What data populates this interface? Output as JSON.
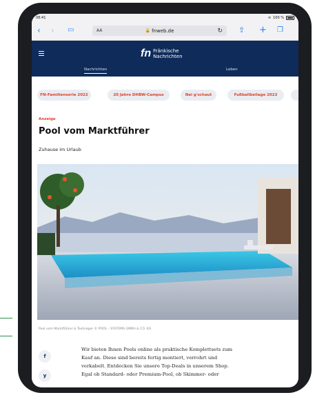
{
  "status": {
    "time": "08:41",
    "battery": "100 %"
  },
  "browser": {
    "text_size_label": "AA",
    "url": "fnweb.de",
    "icons": [
      "back-icon",
      "forward-icon",
      "book-icon",
      "lock-icon",
      "reload-icon",
      "share-icon",
      "plus-icon",
      "tabs-icon"
    ]
  },
  "site": {
    "logo_mark": "fn",
    "logo_line1": "Fränkische",
    "logo_line2": "Nachrichten",
    "nav": [
      {
        "label": "Nachrichten",
        "active": true
      },
      {
        "label": "Leben",
        "active": false
      }
    ]
  },
  "chips": [
    "FN-Familienserie 2022",
    "20 Jahre DHBW-Campus",
    "Nei g'schaut",
    "Fußballbeilage 2022"
  ],
  "article": {
    "sponsor_label": "Anzeige",
    "title": "Pool vom Marktführer",
    "subtitle": "Zuhause im Urlaub",
    "caption": "Pool vom Marktführer & Testsieger © POOL - SYSTEMS GMBH & CO. KG",
    "body_lines": [
      "Wir bieten Ihnen Pools online als praktische Komplettsets zum",
      "Kauf an. Diese sind bereits fertig montiert, verrohrt und",
      "verkabelt. Entdecken Sie unsere Top-Deals in unserem Shop.",
      "Egal ob Standard- oder Premium-Pool, ob Skimmer- oder"
    ]
  },
  "social": [
    {
      "icon": "facebook-icon",
      "glyph": "f"
    },
    {
      "icon": "twitter-icon",
      "glyph": "y"
    }
  ],
  "colors": {
    "navy": "#0e2b5a",
    "accent_red": "#e0402a",
    "ios_blue": "#2f7cf6",
    "device": "#1c1d20"
  }
}
